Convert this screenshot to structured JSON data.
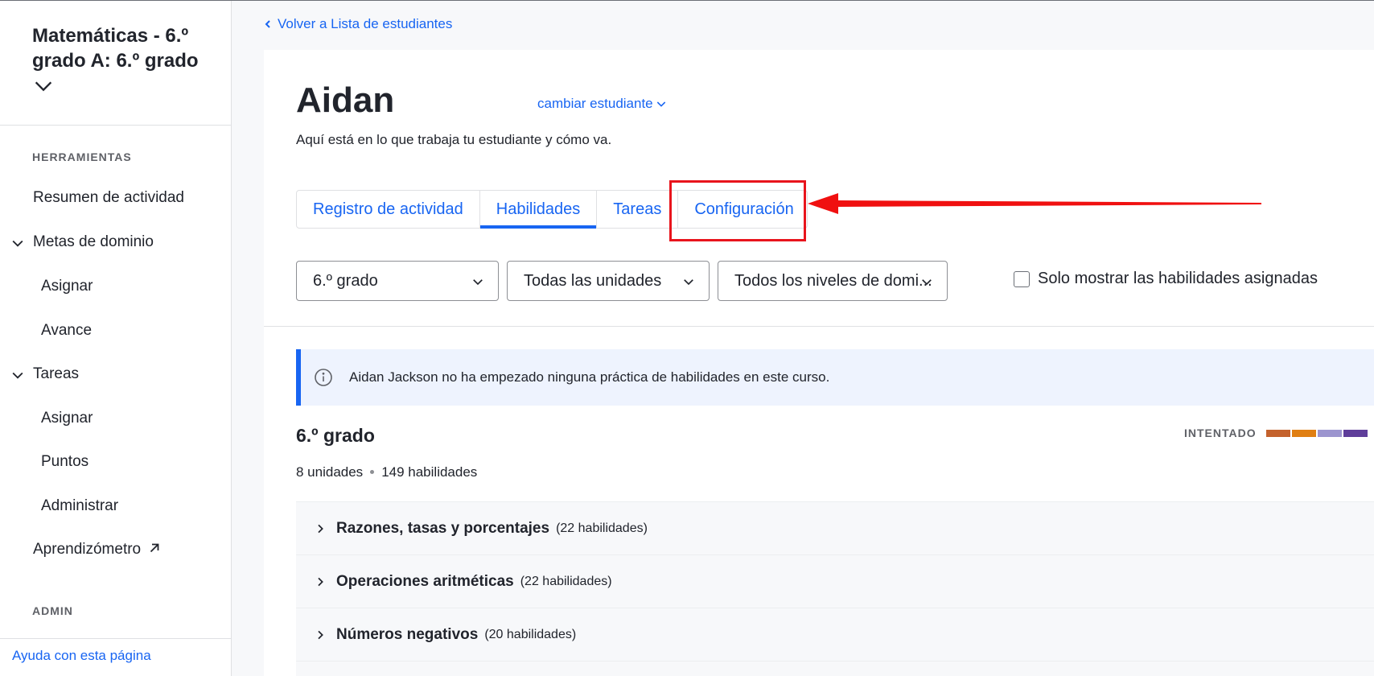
{
  "sidebar": {
    "course_title": "Matemáticas - 6.º grado A: 6.º grado",
    "section_tools": "HERRAMIENTAS",
    "items": {
      "activity_summary": "Resumen de actividad",
      "mastery_goals": "Metas de dominio",
      "mastery_assign": "Asignar",
      "mastery_progress": "Avance",
      "assignments": "Tareas",
      "assignments_assign": "Asignar",
      "assignments_scores": "Puntos",
      "assignments_manage": "Administrar",
      "learnometer": "Aprendizómetro"
    },
    "section_admin": "ADMIN",
    "help_link": "Ayuda con esta página"
  },
  "main": {
    "back_link": "Volver a Lista de estudiantes",
    "student_name": "Aidan",
    "change_student": "cambiar estudiante",
    "subtitle": "Aquí está en lo que trabaja tu estudiante y cómo va.",
    "tabs": [
      {
        "label": "Registro de actividad",
        "active": false
      },
      {
        "label": "Habilidades",
        "active": true
      },
      {
        "label": "Tareas",
        "active": false
      },
      {
        "label": "Configuración",
        "active": false
      }
    ],
    "filters": {
      "grade": "6.º grado",
      "units": "Todas las unidades",
      "levels": "Todos los niveles de domi...",
      "assigned_only_label": "Solo mostrar las habilidades asignadas",
      "assigned_only_checked": false
    },
    "info_banner": "Aidan Jackson no ha empezado ninguna práctica de habilidades en este curso.",
    "grade_title": "6.º grado",
    "legend_label": "INTENTADO",
    "legend_colors": [
      "#c4622d",
      "#e07f13",
      "#9c95cf",
      "#5f3e9a"
    ],
    "counts": {
      "units": "8 unidades",
      "skills": "149 habilidades"
    },
    "units": [
      {
        "name": "Razones, tasas y porcentajes",
        "count": "(22 habilidades)"
      },
      {
        "name": "Operaciones aritméticas",
        "count": "(22 habilidades)"
      },
      {
        "name": "Números negativos",
        "count": "(20 habilidades)"
      }
    ]
  },
  "colors": {
    "link": "#1865f2",
    "highlight": "#e8141c"
  }
}
